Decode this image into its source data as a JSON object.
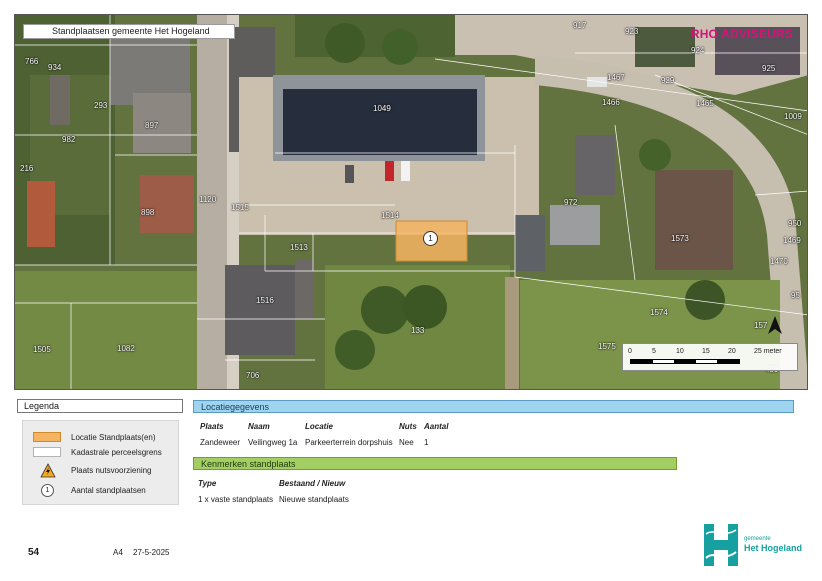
{
  "map": {
    "title": "Standplaatsen gemeente Het Hogeland",
    "brand": "RHO ADVISEURS",
    "site_marker": "1",
    "parcels": [
      "766",
      "934",
      "293",
      "897",
      "982",
      "216",
      "898",
      "1120",
      "1515",
      "1514",
      "1513",
      "1516",
      "1082",
      "1505",
      "706",
      "133",
      "1049",
      "917",
      "923",
      "924",
      "925",
      "1467",
      "929",
      "1466",
      "1465",
      "1009",
      "972",
      "1573",
      "950",
      "1469",
      "1470",
      "95",
      "1574",
      "157",
      "1575",
      "1460",
      "459"
    ],
    "scale": {
      "ticks": [
        "0",
        "5",
        "10",
        "15",
        "20",
        "25 meter"
      ]
    }
  },
  "legend": {
    "title": "Legenda",
    "items": [
      {
        "symbol": "orange-fill-box",
        "label": "Locatie Standplaats(en)"
      },
      {
        "symbol": "white-box",
        "label": "Kadastrale perceelsgrens"
      },
      {
        "symbol": "warning-triangle-icon",
        "label": "Plaats nutsvoorziening"
      },
      {
        "symbol": "count-circle",
        "value": "1",
        "label": "Aantal standplaatsen"
      }
    ]
  },
  "location": {
    "title": "Locatiegegevens",
    "headers": [
      "Plaats",
      "Naam",
      "Locatie",
      "Nuts",
      "Aantal"
    ],
    "row": [
      "Zandeweer",
      "Veilingweg 1a",
      "Parkeerterrein dorpshuis",
      "Nee",
      "1"
    ]
  },
  "features": {
    "title": "Kenmerken standplaats",
    "headers": [
      "Type",
      "Bestaand / Nieuw"
    ],
    "row": [
      "1 x vaste standplaats",
      "Nieuwe standplaats"
    ]
  },
  "footer": {
    "page_number": "54",
    "paper_size": "A4",
    "date": "27-5-2025",
    "logo_small": "gemeente",
    "logo_big": "Het Hogeland"
  },
  "colors": {
    "site": "#f5b461",
    "brand": "#d6127b",
    "location_bar": "#9ed4ef",
    "feature_bar": "#a3cf62",
    "logo": "#16a0a0"
  }
}
